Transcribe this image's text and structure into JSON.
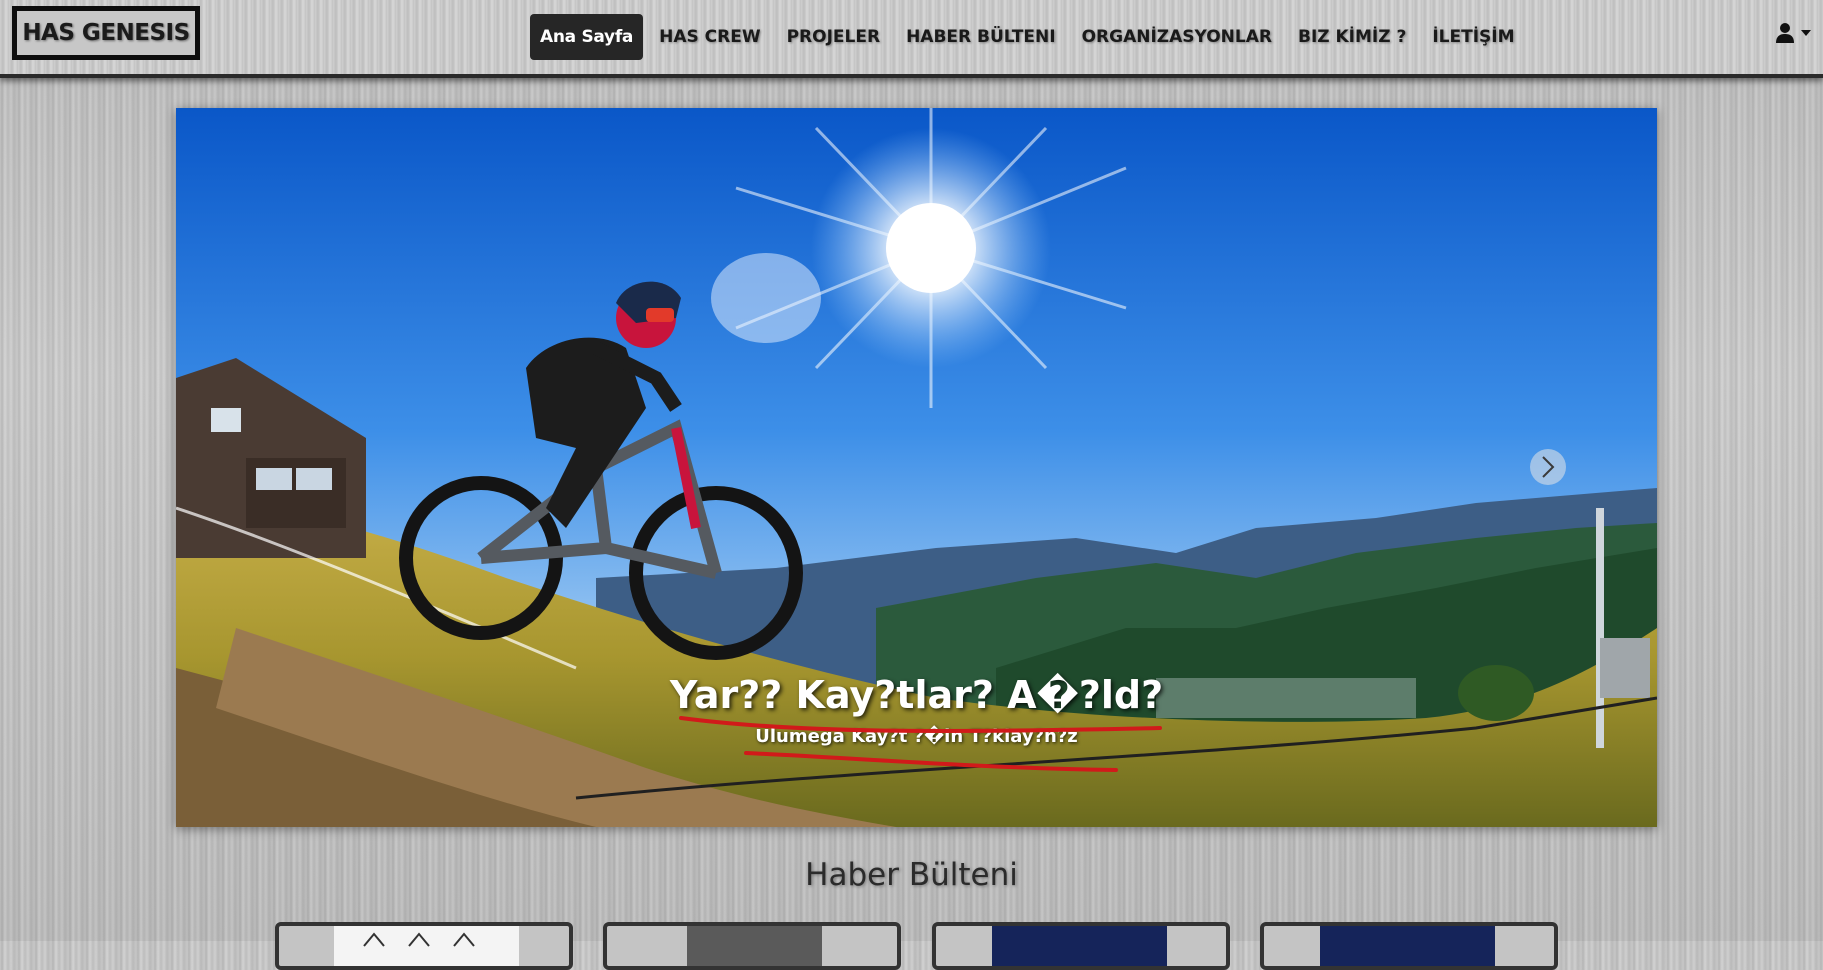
{
  "brand": {
    "name": "HAS GENESIS"
  },
  "nav": {
    "items": [
      {
        "label": "Ana Sayfa",
        "active": true
      },
      {
        "label": "HAS CREW"
      },
      {
        "label": "PROJELER"
      },
      {
        "label": "HABER BÜLTENI"
      },
      {
        "label": "ORGANİZASYONLAR"
      },
      {
        "label": "BIZ KİMİZ ?"
      },
      {
        "label": "İLETİŞİM"
      }
    ],
    "user_icon": "user-icon",
    "dropdown_icon": "caret-down-icon"
  },
  "carousel": {
    "title": "Yar?? Kay?tlar? A�?ld?",
    "subtitle": "Ulumega Kay?t ?�in T?klay?n?z",
    "next_icon": "chevron-right-icon",
    "image_alt": "mountain-bike-rider-jumping"
  },
  "news": {
    "title": "Haber Bülteni",
    "cards": [
      {
        "name": "news-card-1"
      },
      {
        "name": "news-card-2"
      },
      {
        "name": "news-card-3"
      },
      {
        "name": "news-card-4"
      }
    ]
  },
  "colors": {
    "nav_active_bg": "#262626",
    "underline_red": "#d11a1a",
    "sky": "#1e74e0"
  }
}
